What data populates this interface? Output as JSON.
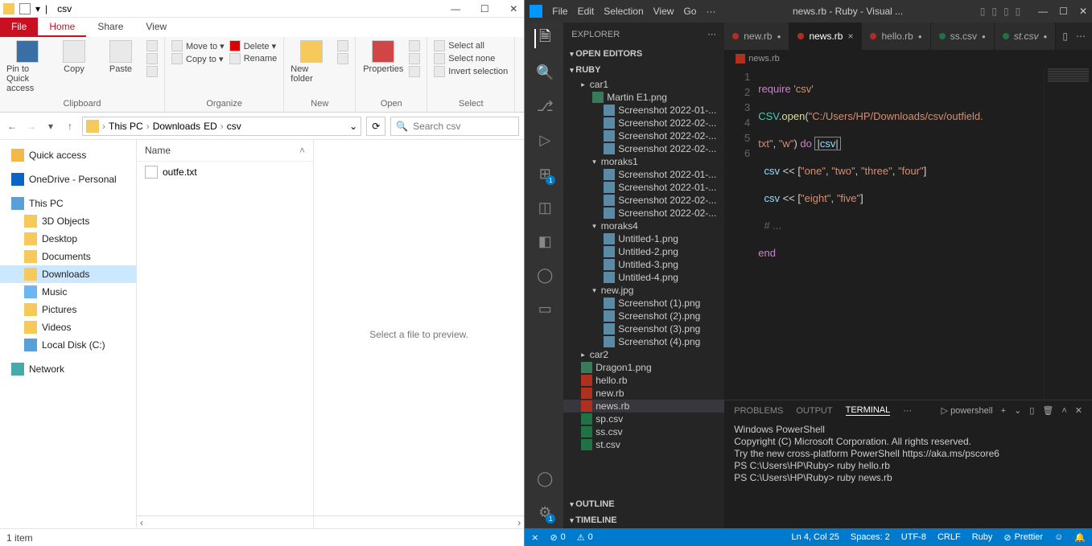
{
  "explorer": {
    "title": "csv",
    "tabs": {
      "file": "File",
      "home": "Home",
      "share": "Share",
      "view": "View"
    },
    "ribbon": {
      "clipboard": {
        "name": "Clipboard",
        "pin": "Pin to Quick access",
        "copy": "Copy",
        "paste": "Paste"
      },
      "organize": {
        "name": "Organize",
        "moveto": "Move to ▾",
        "copyto": "Copy to ▾",
        "delete": "Delete ▾",
        "rename": "Rename"
      },
      "new": {
        "name": "New",
        "newfolder": "New folder"
      },
      "open": {
        "name": "Open",
        "properties": "Properties"
      },
      "select": {
        "name": "Select",
        "selectall": "Select all",
        "selectnone": "Select none",
        "invert": "Invert selection"
      }
    },
    "breadcrumb": {
      "pc": "This PC",
      "downloads": "Downloads",
      "folder": "csv"
    },
    "search_placeholder": "Search csv",
    "nav": {
      "quick": "Quick access",
      "onedrive": "OneDrive - Personal",
      "pc": "This PC",
      "objects3d": "3D Objects",
      "desktop": "Desktop",
      "documents": "Documents",
      "downloads": "Downloads",
      "music": "Music",
      "pictures": "Pictures",
      "videos": "Videos",
      "localdisk": "Local Disk (C:)",
      "network": "Network"
    },
    "columns": {
      "name": "Name"
    },
    "files": [
      {
        "name": "outfe.txt"
      }
    ],
    "preview_text": "Select a file to preview.",
    "status": "1 item"
  },
  "vscode": {
    "menus": [
      "File",
      "Edit",
      "Selection",
      "View",
      "Go",
      "···"
    ],
    "title": "news.rb - Ruby - Visual ...",
    "sidebar": {
      "title": "EXPLORER",
      "open_editors": "OPEN EDITORS",
      "root": "RUBY",
      "outline": "OUTLINE",
      "timeline": "TIMELINE",
      "tree": [
        {
          "name": "car1",
          "type": "folder"
        },
        {
          "name": "Martin E1.png",
          "type": "img",
          "indent": 1,
          "open": true
        },
        {
          "name": "Screenshot 2022-01-...",
          "type": "imgg",
          "indent": 2
        },
        {
          "name": "Screenshot 2022-02-...",
          "type": "imgg",
          "indent": 2
        },
        {
          "name": "Screenshot 2022-02-...",
          "type": "imgg",
          "indent": 2
        },
        {
          "name": "Screenshot 2022-02-...",
          "type": "imgg",
          "indent": 2
        },
        {
          "name": "moraks1",
          "type": "folder",
          "indent": 1,
          "open": true
        },
        {
          "name": "Screenshot 2022-01-...",
          "type": "imgg",
          "indent": 2
        },
        {
          "name": "Screenshot 2022-01-...",
          "type": "imgg",
          "indent": 2
        },
        {
          "name": "Screenshot 2022-02-...",
          "type": "imgg",
          "indent": 2
        },
        {
          "name": "Screenshot 2022-02-...",
          "type": "imgg",
          "indent": 2
        },
        {
          "name": "moraks4",
          "type": "folder",
          "indent": 1,
          "open": true
        },
        {
          "name": "Untitled-1.png",
          "type": "imgg",
          "indent": 2
        },
        {
          "name": "Untitled-2.png",
          "type": "imgg",
          "indent": 2
        },
        {
          "name": "Untitled-3.png",
          "type": "imgg",
          "indent": 2
        },
        {
          "name": "Untitled-4.png",
          "type": "imgg",
          "indent": 2
        },
        {
          "name": "new.jpg",
          "type": "folder",
          "indent": 1,
          "open": true
        },
        {
          "name": "Screenshot (1).png",
          "type": "imgg",
          "indent": 2
        },
        {
          "name": "Screenshot (2).png",
          "type": "imgg",
          "indent": 2
        },
        {
          "name": "Screenshot (3).png",
          "type": "imgg",
          "indent": 2
        },
        {
          "name": "Screenshot (4).png",
          "type": "imgg",
          "indent": 2
        },
        {
          "name": "car2",
          "type": "folder"
        },
        {
          "name": "Dragon1.png",
          "type": "img"
        },
        {
          "name": "hello.rb",
          "type": "rb"
        },
        {
          "name": "new.rb",
          "type": "rb"
        },
        {
          "name": "news.rb",
          "type": "rb",
          "selected": true
        },
        {
          "name": "sp.csv",
          "type": "csv"
        },
        {
          "name": "ss.csv",
          "type": "csv"
        },
        {
          "name": "st.csv",
          "type": "csv"
        }
      ]
    },
    "tabs": [
      {
        "name": "new.rb",
        "type": "rb",
        "modified": true
      },
      {
        "name": "news.rb",
        "type": "rb",
        "active": true,
        "modified": true
      },
      {
        "name": "hello.rb",
        "type": "rb",
        "modified": true
      },
      {
        "name": "ss.csv",
        "type": "csv",
        "modified": true
      },
      {
        "name": "st.csv",
        "type": "csv",
        "modified": true,
        "italic": true
      }
    ],
    "breadcrumb": "news.rb",
    "code": {
      "lines": [
        1,
        2,
        3,
        4,
        5,
        6
      ]
    },
    "panel": {
      "tabs": {
        "problems": "PROBLEMS",
        "output": "OUTPUT",
        "terminal": "TERMINAL"
      },
      "shell": "powershell",
      "lines": [
        "Windows PowerShell",
        "Copyright (C) Microsoft Corporation. All rights reserved.",
        "",
        "Try the new cross-platform PowerShell https://aka.ms/pscore6",
        "",
        "PS C:\\Users\\HP\\Ruby> ruby hello.rb",
        "PS C:\\Users\\HP\\Ruby> ruby news.rb"
      ]
    },
    "status": {
      "errors": "0",
      "warnings": "0",
      "ln": "Ln 4, Col 25",
      "spaces": "Spaces: 2",
      "enc": "UTF-8",
      "eol": "CRLF",
      "lang": "Ruby",
      "prettier": "Prettier"
    }
  }
}
